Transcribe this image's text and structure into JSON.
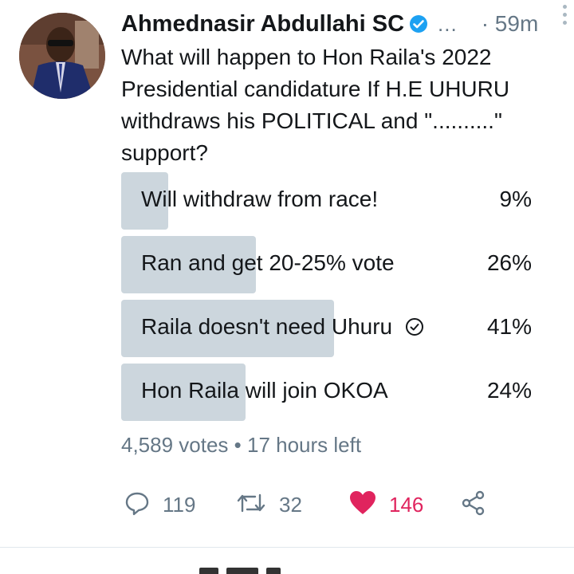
{
  "tweet": {
    "author_name": "Ahmednasir Abdullahi SC",
    "handle_truncated": "...",
    "time": "· 59m",
    "text": "What will happen to Hon Raila's 2022 Presidential candidature If H.E UHURU withdraws his POLITICAL and \"..........\" support?"
  },
  "poll": {
    "options": [
      {
        "label": "Will withdraw from race!",
        "percent": "9%",
        "fraction": 0.09,
        "selected": false
      },
      {
        "label": "Ran and get 20-25% vote",
        "percent": "26%",
        "fraction": 0.26,
        "selected": false
      },
      {
        "label": "Raila doesn't need Uhuru",
        "percent": "41%",
        "fraction": 0.41,
        "selected": true
      },
      {
        "label": "Hon Raila will join OKOA",
        "percent": "24%",
        "fraction": 0.24,
        "selected": false
      }
    ],
    "meta": "4,589 votes • 17 hours left"
  },
  "actions": {
    "reply_count": "119",
    "retweet_count": "32",
    "like_count": "146"
  },
  "icons": {
    "verified": "verified-badge-icon",
    "more": "more-vertical-icon",
    "reply": "reply-icon",
    "retweet": "retweet-icon",
    "like": "heart-icon",
    "share": "share-icon",
    "check": "check-circle-icon"
  },
  "colors": {
    "verified": "#1da1f2",
    "poll_bar": "#ccd6dd",
    "like": "#e0245e",
    "secondary_text": "#657786"
  }
}
